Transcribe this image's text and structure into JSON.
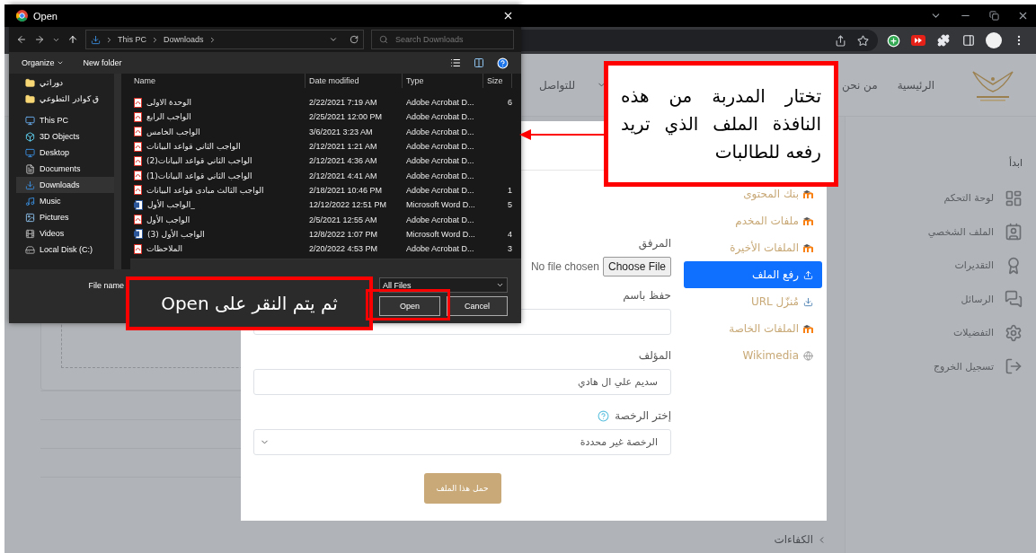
{
  "file_dialog": {
    "title": "Open",
    "path": {
      "computer": "This PC",
      "folder": "Downloads"
    },
    "search": {
      "placeholder": "Search Downloads"
    },
    "commands": {
      "organize": "Organize",
      "new_folder": "New folder"
    },
    "nav": [
      {
        "label": "دوراتي",
        "kind": "folder",
        "selected": false
      },
      {
        "label": "ق كوادر التطوعي",
        "kind": "folder",
        "selected": false
      },
      {
        "label": "This PC",
        "kind": "pc",
        "selected": false
      },
      {
        "label": "3D Objects",
        "kind": "objects",
        "selected": false
      },
      {
        "label": "Desktop",
        "kind": "desktop",
        "selected": false
      },
      {
        "label": "Documents",
        "kind": "documents",
        "selected": false
      },
      {
        "label": "Downloads",
        "kind": "downloads",
        "selected": true
      },
      {
        "label": "Music",
        "kind": "music",
        "selected": false
      },
      {
        "label": "Pictures",
        "kind": "pictures",
        "selected": false
      },
      {
        "label": "Videos",
        "kind": "videos",
        "selected": false
      },
      {
        "label": "Local Disk (C:)",
        "kind": "disk",
        "selected": false
      }
    ],
    "columns": {
      "name": "Name",
      "date": "Date modified",
      "type": "Type",
      "size": "Size"
    },
    "files": [
      {
        "name": "الوحدة الاولى",
        "date": "2/22/2021 7:19 AM",
        "type": "Adobe Acrobat D...",
        "size": "6",
        "kind": "pdf"
      },
      {
        "name": "الواجب الرابع",
        "date": "2/25/2021 12:00 PM",
        "type": "Adobe Acrobat D...",
        "kind": "pdf"
      },
      {
        "name": "الواجب الخامس",
        "date": "3/6/2021 3:23 AM",
        "type": "Adobe Acrobat D...",
        "kind": "pdf"
      },
      {
        "name": "الواجب الثاني قواعد البيانات",
        "date": "2/12/2021 1:21 AM",
        "type": "Adobe Acrobat D...",
        "kind": "pdf"
      },
      {
        "name": "الواجب الثاني قواعد البيانات(2)",
        "date": "2/12/2021 4:36 AM",
        "type": "Adobe Acrobat D...",
        "kind": "pdf"
      },
      {
        "name": "الواجب الثاني قواعد البيانات(1)",
        "date": "2/12/2021 4:41 AM",
        "type": "Adobe Acrobat D...",
        "kind": "pdf"
      },
      {
        "name": "الواجب الثالث مبادى قواعد البيانات",
        "date": "2/18/2021 10:46 PM",
        "type": "Adobe Acrobat D...",
        "size": "1",
        "kind": "pdf"
      },
      {
        "name": "الواجب الأول_",
        "date": "12/12/2022 12:51 PM",
        "type": "Microsoft Word D...",
        "size": "5",
        "kind": "word"
      },
      {
        "name": "الواجب الأول",
        "date": "2/5/2021 12:55 AM",
        "type": "Adobe Acrobat D...",
        "kind": "pdf"
      },
      {
        "name": "الواجب الأول (3)",
        "date": "12/8/2022 1:07 PM",
        "type": "Microsoft Word D...",
        "size": "4",
        "kind": "word"
      },
      {
        "name": "الملاحظات",
        "date": "2/20/2022 4:53 PM",
        "type": "Adobe Acrobat D...",
        "size": "3",
        "kind": "pdf"
      }
    ],
    "file_name_label": "File name",
    "filter": "All Files",
    "buttons": {
      "open": "Open",
      "cancel": "Cancel"
    }
  },
  "site": {
    "nav": [
      "الرئيسية",
      "من نحن",
      "للتواصل"
    ],
    "sidebar": {
      "heading": "ابدأ",
      "items": [
        {
          "label": "لوحة التحكم",
          "kind": "dashboard"
        },
        {
          "label": "الملف الشخصي",
          "kind": "profile"
        },
        {
          "label": "التقديرات",
          "kind": "grades"
        },
        {
          "label": "الرسائل",
          "kind": "messages"
        },
        {
          "label": "التفضيلات",
          "kind": "settings"
        },
        {
          "label": "تسجيل الخروج",
          "kind": "logout"
        }
      ]
    },
    "competencies": "الكفاءات"
  },
  "file_picker": {
    "repositories": [
      {
        "label": "بنك المحتوى",
        "kind": "moodle",
        "selected": false
      },
      {
        "label": "ملفات المخدم",
        "kind": "moodle",
        "selected": false
      },
      {
        "label": "الملفات الأخيرة",
        "kind": "moodle",
        "selected": false
      },
      {
        "label": "رفع الملف",
        "kind": "upload",
        "selected": true
      },
      {
        "label": "مُنزّل URL",
        "kind": "url",
        "selected": false
      },
      {
        "label": "الملفات الخاصة",
        "kind": "moodle",
        "selected": false
      },
      {
        "label": "Wikimedia",
        "kind": "wikimedia",
        "selected": false
      }
    ],
    "attachment": {
      "label": "المرفق",
      "button": "Choose File",
      "status": "No file chosen"
    },
    "save_as": {
      "label": "حفظ باسم"
    },
    "author": {
      "label": "المؤلف",
      "value": "سديم علي ال هادي"
    },
    "license": {
      "label": "إختر الرخصة",
      "value": "الرخصة غير محددة"
    },
    "submit": "حمل هذا الملف"
  },
  "annotations": [
    {
      "text": "تختار المدربة من هذه النافذة الملف الذي تريد رفعه للطالبات"
    },
    {
      "text": "ثم يتم النقر على Open"
    }
  ]
}
